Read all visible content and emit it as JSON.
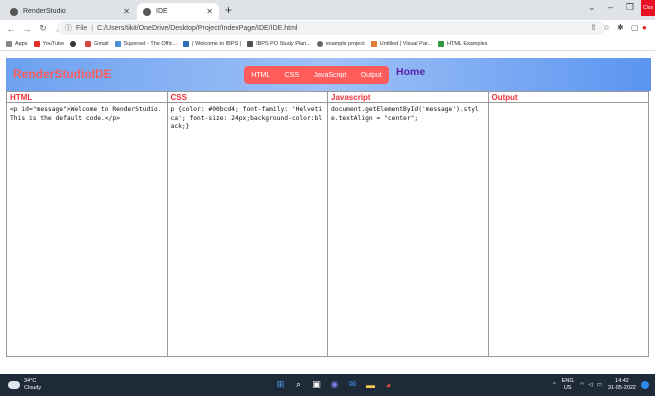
{
  "browser": {
    "tabs": [
      {
        "label": "RenderStudio",
        "icon": "globe-icon"
      },
      {
        "label": "IDE",
        "icon": "globe-icon"
      }
    ],
    "new_tab": "+",
    "close_label": "Clos",
    "address": {
      "info": "File",
      "url": "C:/Users/tikit/OneDrive/Desktop/Project/IndexPage/IDE/IDE.html"
    },
    "bookmarks": [
      {
        "label": "Apps",
        "color": "#3c7be0"
      },
      {
        "label": "YouTube",
        "color": "#e52d27"
      },
      {
        "label": "",
        "color": "#333333"
      },
      {
        "label": "Gmail",
        "color": "#d44638"
      },
      {
        "label": "Superset - The Offic...",
        "color": "#4a90d9"
      },
      {
        "label": "| Welcome to IBPS |",
        "color": "#2a6fb8"
      },
      {
        "label": "IBPS PO Study Plan...",
        "color": "#555555"
      },
      {
        "label": "example project",
        "color": "#666666"
      },
      {
        "label": "Untitled | Visual Par...",
        "color": "#e07b39"
      },
      {
        "label": "HTML Examples",
        "color": "#2f9a3e"
      }
    ]
  },
  "app": {
    "brand": "RenderStudioIDE",
    "nav": [
      "HTML",
      "CSS",
      "JavaScript",
      "Output"
    ],
    "home": "Home",
    "panes": [
      {
        "title": "HTML",
        "code": "<p id=\"message\">Welcome to RenderStudio. This is the default code.</p>"
      },
      {
        "title": "CSS",
        "code": "p {color: #00bcd4; font-family: 'Helvetica'; font-size: 24px;background-color:black;}"
      },
      {
        "title": "Javascript",
        "code": "document.getElementById('message').style.textAlign = \"center\";"
      },
      {
        "title": "Output",
        "code": ""
      }
    ]
  },
  "taskbar": {
    "weather_temp": "34°C",
    "weather_desc": "Cloudy",
    "lang_top": "ENG",
    "lang_bottom": "US",
    "time": "14:42",
    "date": "31-05-2022"
  },
  "colors": {
    "accent": "#ff5b5b",
    "home": "#5b1fa8",
    "pane_title": "#f0323a"
  }
}
